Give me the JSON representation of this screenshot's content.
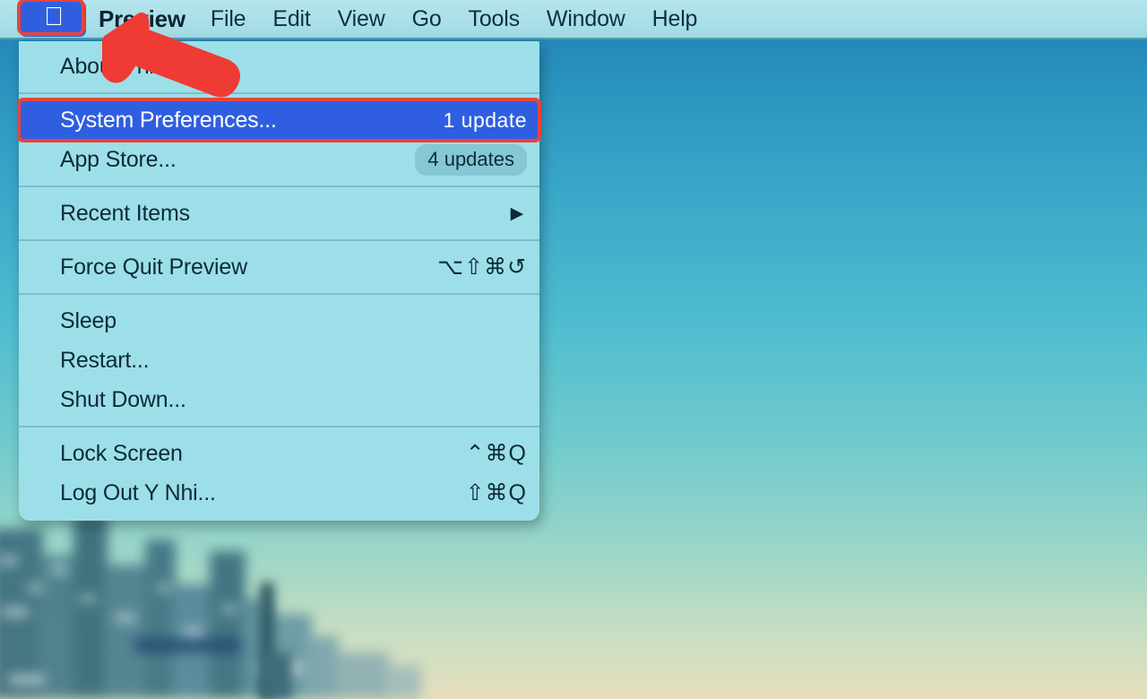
{
  "menubar": {
    "apple_icon": "apple-logo-icon",
    "app_name": "Preview",
    "items": [
      "File",
      "Edit",
      "View",
      "Go",
      "Tools",
      "Window",
      "Help"
    ]
  },
  "apple_menu": {
    "groups": [
      {
        "items": [
          {
            "label": "About This Mac",
            "right": "",
            "type": "plain"
          }
        ]
      },
      {
        "items": [
          {
            "label": "System Preferences...",
            "right": "1 update",
            "type": "selected"
          },
          {
            "label": "App Store...",
            "right": "4 updates",
            "type": "badge"
          }
        ]
      },
      {
        "items": [
          {
            "label": "Recent Items",
            "right": "▶",
            "type": "submenu"
          }
        ]
      },
      {
        "items": [
          {
            "label": "Force Quit Preview",
            "right": "⌥⇧⌘↺",
            "type": "shortcut"
          }
        ]
      },
      {
        "items": [
          {
            "label": "Sleep",
            "right": "",
            "type": "plain"
          },
          {
            "label": "Restart...",
            "right": "",
            "type": "plain"
          },
          {
            "label": "Shut Down...",
            "right": "",
            "type": "plain"
          }
        ]
      },
      {
        "items": [
          {
            "label": "Lock Screen",
            "right": "⌃⌘Q",
            "type": "shortcut"
          },
          {
            "label": "Log Out Y Nhi...",
            "right": "⇧⌘Q",
            "type": "shortcut"
          }
        ]
      }
    ]
  },
  "annotations": {
    "pointer_arrow": "red-arrow-pointing-up-left",
    "highlight_color": "#e8443b",
    "selection_color": "#2f5fe0"
  },
  "desktop": {
    "wallpaper_description": "blurred city skyline with blue to cream sky gradient"
  }
}
